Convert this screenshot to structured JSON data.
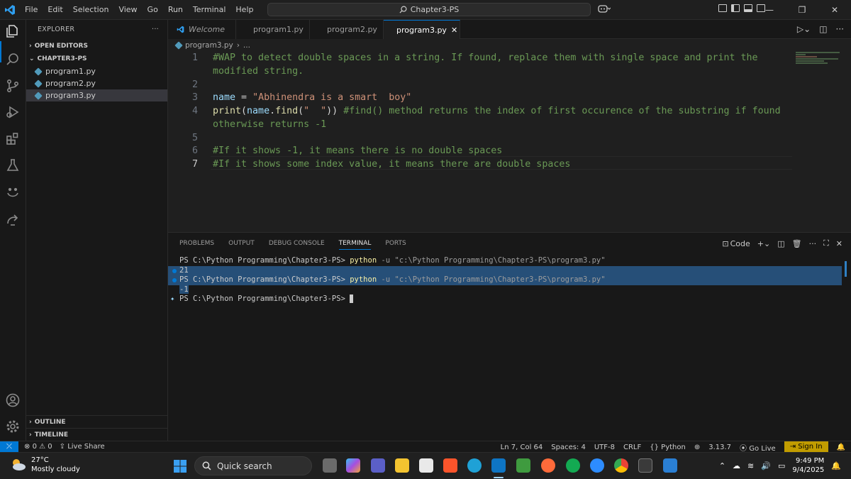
{
  "window": {
    "menu": [
      "File",
      "Edit",
      "Selection",
      "View",
      "Go",
      "Run",
      "Terminal",
      "Help"
    ],
    "command_center": "Chapter3-PS"
  },
  "sidebar": {
    "title": "EXPLORER",
    "open_editors": "OPEN EDITORS",
    "folder": "CHAPTER3-PS",
    "files": [
      "program1.py",
      "program2.py",
      "program3.py"
    ],
    "selected_file": "program3.py",
    "outline": "OUTLINE",
    "timeline": "TIMELINE"
  },
  "tabs": [
    {
      "label": "Welcome"
    },
    {
      "label": "program1.py"
    },
    {
      "label": "program2.py"
    },
    {
      "label": "program3.py"
    }
  ],
  "breadcrumb": {
    "file": "program3.py",
    "rest": "..."
  },
  "editor": {
    "line_numbers": [
      "1",
      "",
      "2",
      "3",
      "4",
      "",
      "5",
      "6",
      "7"
    ],
    "line1a": "#WAP to detect double spaces in a string. If found, replace them with single space and print the",
    "line1b": "modified string.",
    "line3_var": "name",
    "line3_eq": " = ",
    "line3_str": "\"Abhinendra is a smart  boy\"",
    "line4_fn1": "print",
    "line4_p1": "(",
    "line4_var": "name",
    "line4_dot": ".",
    "line4_fn2": "find",
    "line4_p2": "(",
    "line4_str": "\"  \"",
    "line4_p3": "))",
    "line4_cm": " #find() method returns the index of first occurence of the substring if found",
    "line4b": "otherwise returns -1",
    "line6": "#If it shows -1, it means there is no double spaces",
    "line7": "#If it shows some index value, it means there are double spaces"
  },
  "panel": {
    "tabs": [
      "PROBLEMS",
      "OUTPUT",
      "DEBUG CONSOLE",
      "TERMINAL",
      "PORTS"
    ],
    "active_tab": "TERMINAL",
    "shell_label": "Code",
    "terminal": {
      "prompt": "PS C:\\Python Programming\\Chapter3-PS> ",
      "cmd1": "python",
      "args1": " -u \"c:\\Python Programming\\Chapter3-PS\\program3.py\"",
      "out1": "21",
      "cmd2": "python",
      "args2": " -u \"c:\\Python Programming\\Chapter3-PS\\program3.py\"",
      "out2": "-1"
    }
  },
  "status": {
    "errors": "0",
    "warnings": "0",
    "live_share": "Live Share",
    "position": "Ln 7, Col 64",
    "spaces": "Spaces: 4",
    "encoding": "UTF-8",
    "eol": "CRLF",
    "language": "Python",
    "python_version": "3.13.7",
    "go_live": "Go Live",
    "sign_in": "Sign In"
  },
  "taskbar": {
    "temperature": "27°C",
    "weather": "Mostly cloudy",
    "search_placeholder": "Quick search",
    "time": "9:49 PM",
    "date": "9/4/2025"
  },
  "colors": {
    "accent": "#0078d4",
    "comment": "#6a9955",
    "string": "#ce9178",
    "variable": "#9cdcfe",
    "function": "#dcdcaa",
    "signin": "#c19c00"
  }
}
